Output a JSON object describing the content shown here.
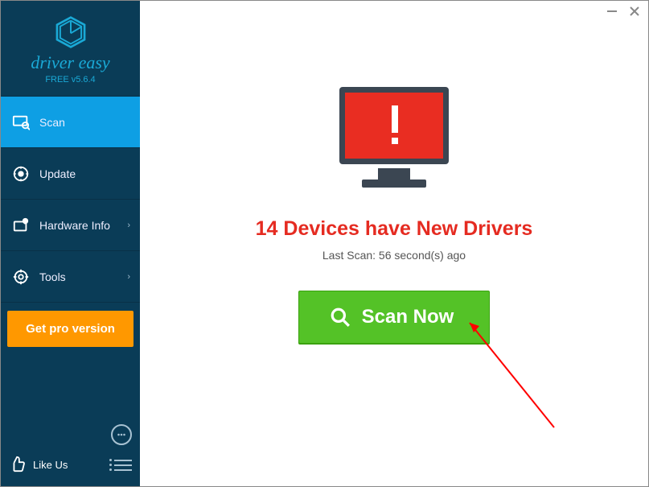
{
  "brand": {
    "name": "driver easy",
    "version": "FREE v5.6.4"
  },
  "sidebar": {
    "items": [
      {
        "label": "Scan"
      },
      {
        "label": "Update"
      },
      {
        "label": "Hardware Info"
      },
      {
        "label": "Tools"
      }
    ],
    "pro_label": "Get pro version",
    "like_us_label": "Like Us"
  },
  "main": {
    "headline": "14 Devices have New Drivers",
    "last_scan": "Last Scan: 56 second(s) ago",
    "scan_button": "Scan Now"
  },
  "colors": {
    "sidebar_bg": "#0a3c57",
    "active_bg": "#0e9fe4",
    "pro_bg": "#ff9800",
    "scan_green": "#54c227",
    "alert_red": "#e92d22",
    "headline_red": "#e52b21"
  }
}
